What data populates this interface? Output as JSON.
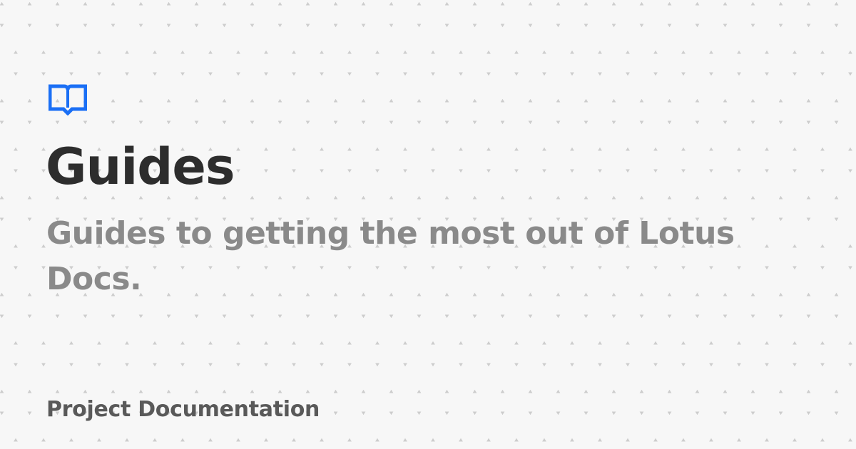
{
  "card": {
    "title": "Guides",
    "subtitle": "Guides to getting the most out of Lotus Docs.",
    "footer": "Project Documentation",
    "logo_icon": "open-book-icon",
    "colors": {
      "background": "#f7f7f7",
      "accent": "#1a6ff5",
      "title": "#2d2d2d",
      "subtitle": "#8a8a8a",
      "footer": "#595959",
      "pattern": "#c9c9c9"
    }
  }
}
